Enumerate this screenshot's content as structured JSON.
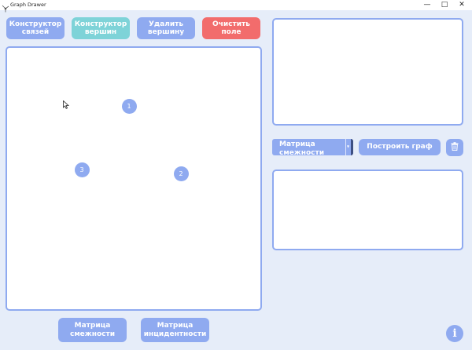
{
  "window": {
    "title": "Graph Drawer",
    "minimize_icon": "minimize-icon",
    "maximize_icon": "maximize-icon",
    "close_icon": "close-icon"
  },
  "toolbar": {
    "edge_constructor": "Конструктор связей",
    "vertex_constructor": "Конструктор вершин",
    "delete_vertex": "Удалить вершину",
    "clear_field": "Очистить поле"
  },
  "canvas": {
    "vertices": [
      {
        "label": "1"
      },
      {
        "label": "2"
      },
      {
        "label": "3"
      }
    ]
  },
  "controls": {
    "matrix_type_selected": "Матрица смежности",
    "build_graph": "Построить граф",
    "trash_icon": "trash-icon"
  },
  "bottom": {
    "adjacency_matrix": "Матрица смежности",
    "incidence_matrix": "Матрица инцидентности",
    "info_icon": "info-icon"
  },
  "colors": {
    "accent": "#8faaf0",
    "teal": "#7ed3d8",
    "danger": "#f26c6c",
    "background": "#e6edf9"
  }
}
